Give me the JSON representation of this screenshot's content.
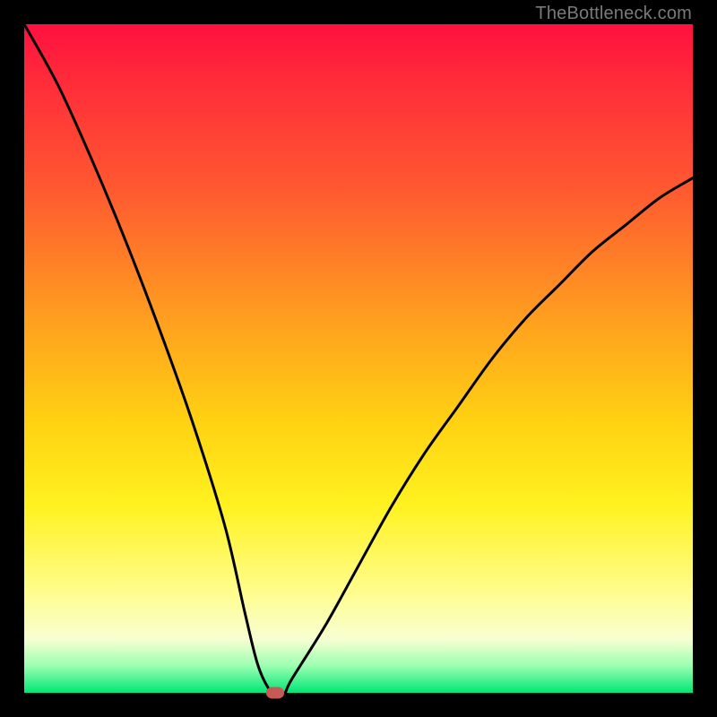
{
  "watermark": "TheBottleneck.com",
  "colors": {
    "bg": "#000000",
    "gradient_top": "#ff103f",
    "gradient_bottom": "#00e676",
    "curve": "#000000",
    "marker": "#c75a55",
    "watermark_text": "#7a7a7a"
  },
  "chart_data": {
    "type": "line",
    "title": "",
    "xlabel": "",
    "ylabel": "",
    "xlim": [
      0,
      100
    ],
    "ylim": [
      0,
      100
    ],
    "grid": false,
    "legend": false,
    "series": [
      {
        "name": "bottleneck-curve",
        "x": [
          0,
          5,
          10,
          15,
          20,
          25,
          30,
          33,
          35,
          37,
          38,
          39,
          40,
          45,
          50,
          55,
          60,
          65,
          70,
          75,
          80,
          85,
          90,
          95,
          100
        ],
        "values": [
          100,
          91,
          80,
          68,
          55,
          41,
          25,
          12,
          4,
          0,
          0,
          0,
          2,
          10,
          19,
          28,
          36,
          43,
          50,
          56,
          61,
          66,
          70,
          74,
          77
        ]
      }
    ],
    "marker": {
      "x": 37.5,
      "y": 0
    },
    "annotations": []
  }
}
